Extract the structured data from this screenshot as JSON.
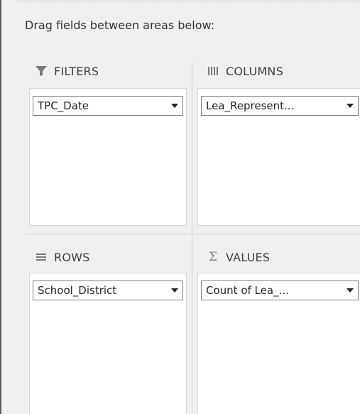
{
  "hint_text": "Drag fields between areas below:",
  "areas": {
    "filters": {
      "label": "FILTERS",
      "icon": "filter-icon",
      "field": "TPC_Date"
    },
    "columns": {
      "label": "COLUMNS",
      "icon": "columns-icon",
      "field": "Lea_Represent..."
    },
    "rows": {
      "label": "ROWS",
      "icon": "rows-icon",
      "field": "School_District"
    },
    "values": {
      "label": "VALUES",
      "icon": "sigma-icon",
      "field": "Count of Lea_..."
    }
  }
}
